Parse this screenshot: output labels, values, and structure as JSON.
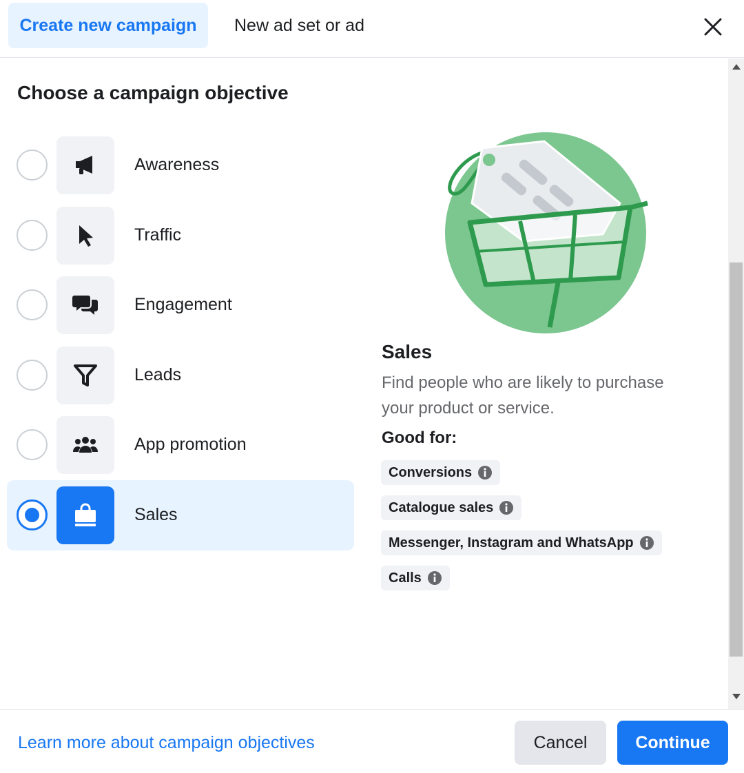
{
  "header": {
    "tabs": [
      {
        "label": "Create new campaign",
        "active": true
      },
      {
        "label": "New ad set or ad",
        "active": false
      }
    ],
    "close_icon": "close-icon"
  },
  "main": {
    "title": "Choose a campaign objective",
    "objectives": [
      {
        "label": "Awareness",
        "icon": "megaphone-icon",
        "selected": false
      },
      {
        "label": "Traffic",
        "icon": "cursor-icon",
        "selected": false
      },
      {
        "label": "Engagement",
        "icon": "chat-bubbles-icon",
        "selected": false
      },
      {
        "label": "Leads",
        "icon": "funnel-icon",
        "selected": false
      },
      {
        "label": "App promotion",
        "icon": "people-icon",
        "selected": false
      },
      {
        "label": "Sales",
        "icon": "shopping-bag-icon",
        "selected": true
      }
    ],
    "detail": {
      "illustration": "shopping-cart-tag-illustration",
      "title": "Sales",
      "description": "Find people who are likely to purchase your product or service.",
      "good_for_label": "Good for:",
      "chips": [
        "Conversions",
        "Catalogue sales",
        "Messenger, Instagram and WhatsApp",
        "Calls"
      ]
    }
  },
  "footer": {
    "learn_more": "Learn more about campaign objectives",
    "cancel_label": "Cancel",
    "continue_label": "Continue"
  },
  "colors": {
    "accent": "#1877f2",
    "selected_bg": "#e7f3ff",
    "chip_bg": "#f0f2f5",
    "illustration_green": "#7cc68f",
    "illustration_dark_green": "#2e9a4e"
  }
}
